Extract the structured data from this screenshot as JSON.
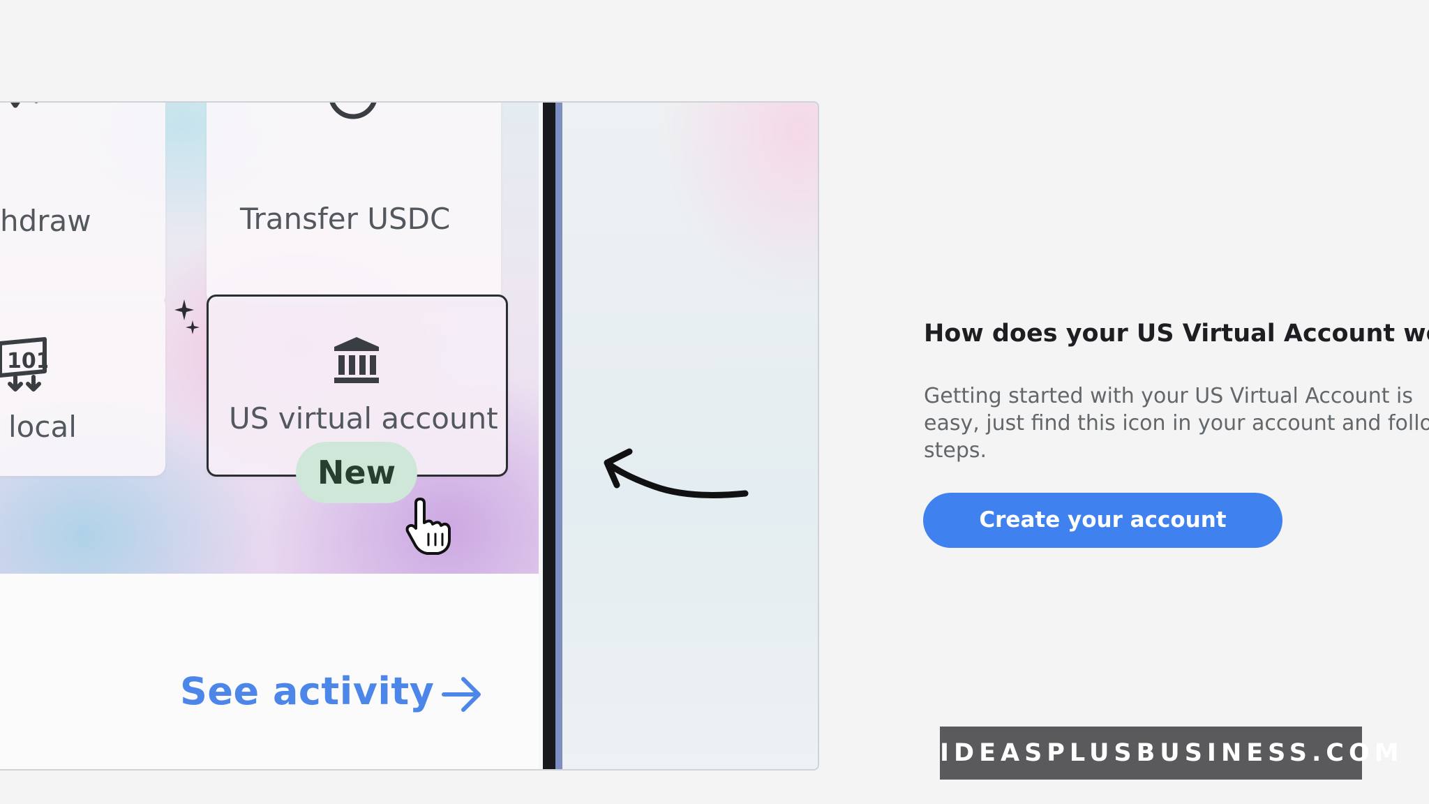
{
  "app_panel": {
    "cards": [
      {
        "label": "hdraw",
        "icon": "withdraw-icon"
      },
      {
        "label": "Transfer USDC",
        "icon": "transfer-icon"
      },
      {
        "label": "local",
        "icon": "money-local-icon"
      },
      {
        "label": "US virtual account",
        "icon": "bank-icon"
      }
    ],
    "new_badge": "New",
    "see_activity": "See activity"
  },
  "info": {
    "title": "How does your US Virtual Account work?",
    "body_lines": [
      "Getting started with your US Virtual Account is",
      "easy, just find this icon in your account and follow",
      "steps."
    ],
    "cta_label": "Create your account"
  },
  "watermark": "IDEASPLUSBUSINESS.COM",
  "colors": {
    "accent_blue": "#3f82ef",
    "link_blue": "#4c86e8",
    "badge_green": "#cfe7d8",
    "watermark_bg": "#5a5a5c"
  }
}
